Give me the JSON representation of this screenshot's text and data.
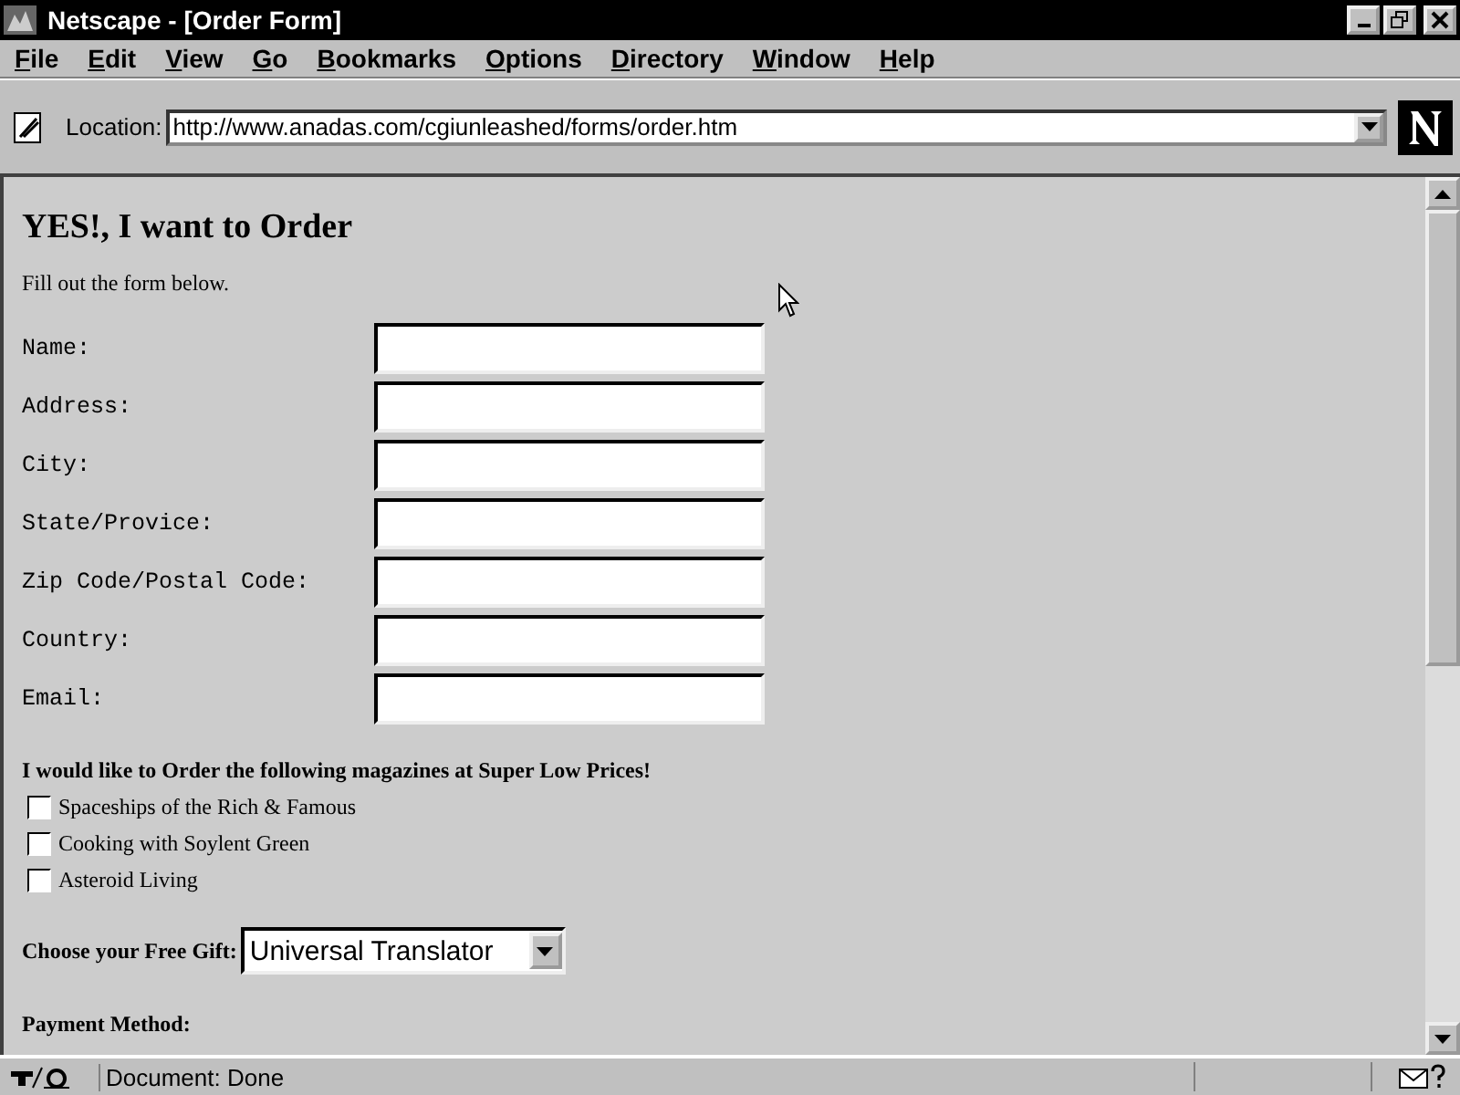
{
  "window": {
    "title": "Netscape - [Order Form]"
  },
  "menu": [
    "File",
    "Edit",
    "View",
    "Go",
    "Bookmarks",
    "Options",
    "Directory",
    "Window",
    "Help"
  ],
  "location": {
    "label": "Location:",
    "url": "http://www.anadas.com/cgiunleashed/forms/order.htm"
  },
  "page": {
    "heading": "YES!, I want to Order",
    "intro": "Fill out the form below.",
    "fields": [
      {
        "label": "Name:"
      },
      {
        "label": "Address:"
      },
      {
        "label": "City:"
      },
      {
        "label": "State/Provice:"
      },
      {
        "label": "Zip Code/Postal Code:"
      },
      {
        "label": "Country:"
      },
      {
        "label": "Email:"
      }
    ],
    "magazines_heading": "I would like to Order the following magazines at Super Low Prices!",
    "magazines": [
      {
        "label": "Spaceships of the Rich & Famous",
        "checked": false
      },
      {
        "label": "Cooking with Soylent Green",
        "checked": false
      },
      {
        "label": "Asteroid Living",
        "checked": false
      }
    ],
    "gift": {
      "label": "Choose your Free Gift:",
      "value": "Universal Translator"
    },
    "payment_heading": "Payment Method:"
  },
  "status_bar": {
    "text": "Document: Done"
  }
}
